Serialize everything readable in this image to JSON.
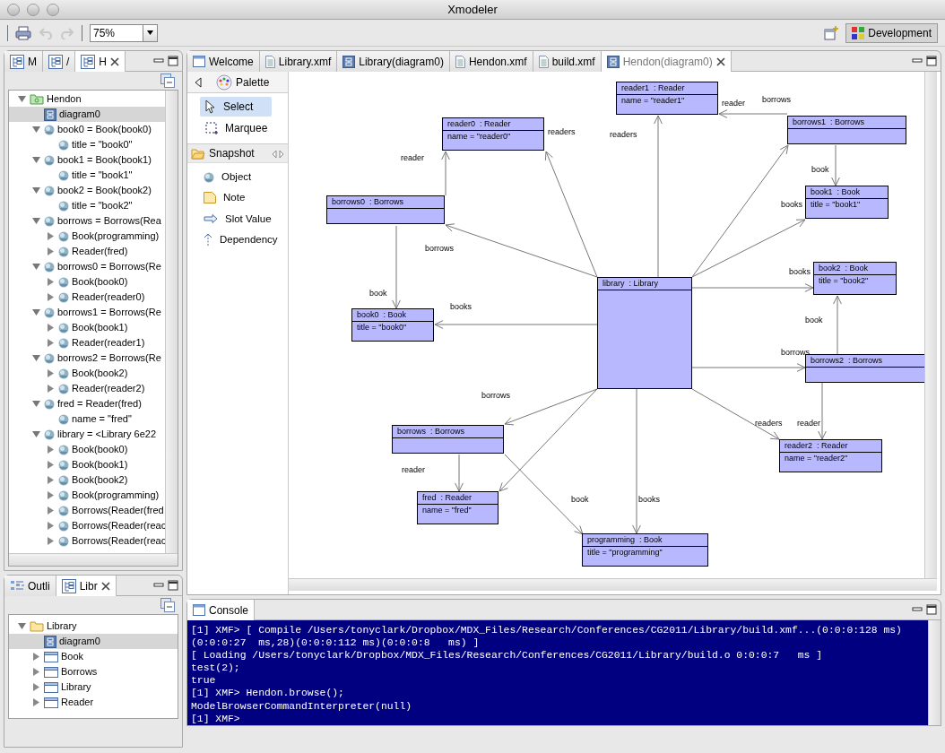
{
  "window": {
    "title": "Xmodeler"
  },
  "toolbar": {
    "zoom": "75%",
    "undo_disabled": true,
    "redo_disabled": true,
    "perspective": {
      "label": "Development",
      "selected": true
    }
  },
  "browser_panel": {
    "tabs": [
      {
        "label": "M",
        "selected": false
      },
      {
        "label": "/",
        "selected": false
      },
      {
        "label": "H",
        "selected": true
      }
    ],
    "tree": [
      {
        "label": "Hendon",
        "kind": "package",
        "expanded": true,
        "selected": false,
        "children": [
          {
            "label": "diagram0",
            "kind": "diagram",
            "selected": true
          },
          {
            "label": "book0 = Book(book0)",
            "kind": "object",
            "expanded": true,
            "selected": false,
            "children": [
              {
                "label": "title = \"book0\"",
                "kind": "object",
                "selected": false
              }
            ]
          },
          {
            "label": "book1 = Book(book1)",
            "kind": "object",
            "expanded": true,
            "selected": false,
            "children": [
              {
                "label": "title = \"book1\"",
                "kind": "object",
                "selected": false
              }
            ]
          },
          {
            "label": "book2 = Book(book2)",
            "kind": "object",
            "expanded": true,
            "selected": false,
            "children": [
              {
                "label": "title = \"book2\"",
                "kind": "object",
                "selected": false
              }
            ]
          },
          {
            "label": "borrows = Borrows(Rea",
            "kind": "object",
            "expanded": true,
            "selected": false,
            "children": [
              {
                "label": "Book(programming)",
                "kind": "object",
                "expanded": false,
                "selected": false
              },
              {
                "label": "Reader(fred)",
                "kind": "object",
                "expanded": false,
                "selected": false
              }
            ]
          },
          {
            "label": "borrows0 = Borrows(Re",
            "kind": "object",
            "expanded": true,
            "selected": false,
            "children": [
              {
                "label": "Book(book0)",
                "kind": "object",
                "expanded": false,
                "selected": false
              },
              {
                "label": "Reader(reader0)",
                "kind": "object",
                "expanded": false,
                "selected": false
              }
            ]
          },
          {
            "label": "borrows1 = Borrows(Re",
            "kind": "object",
            "expanded": true,
            "selected": false,
            "children": [
              {
                "label": "Book(book1)",
                "kind": "object",
                "expanded": false,
                "selected": false
              },
              {
                "label": "Reader(reader1)",
                "kind": "object",
                "expanded": false,
                "selected": false
              }
            ]
          },
          {
            "label": "borrows2 = Borrows(Re",
            "kind": "object",
            "expanded": true,
            "selected": false,
            "children": [
              {
                "label": "Book(book2)",
                "kind": "object",
                "expanded": false,
                "selected": false
              },
              {
                "label": "Reader(reader2)",
                "kind": "object",
                "expanded": false,
                "selected": false
              }
            ]
          },
          {
            "label": "fred = Reader(fred)",
            "kind": "object",
            "expanded": true,
            "selected": false,
            "children": [
              {
                "label": "name = \"fred\"",
                "kind": "object",
                "selected": false
              }
            ]
          },
          {
            "label": "library = <Library 6e22",
            "kind": "object",
            "expanded": true,
            "selected": false,
            "children": [
              {
                "label": "Book(book0)",
                "kind": "object",
                "expanded": false,
                "selected": false
              },
              {
                "label": "Book(book1)",
                "kind": "object",
                "expanded": false,
                "selected": false
              },
              {
                "label": "Book(book2)",
                "kind": "object",
                "expanded": false,
                "selected": false
              },
              {
                "label": "Book(programming)",
                "kind": "object",
                "expanded": false,
                "selected": false
              },
              {
                "label": "Borrows(Reader(fred",
                "kind": "object",
                "expanded": false,
                "selected": false
              },
              {
                "label": "Borrows(Reader(reac",
                "kind": "object",
                "expanded": false,
                "selected": false
              },
              {
                "label": "Borrows(Reader(reac",
                "kind": "object",
                "expanded": false,
                "selected": false
              }
            ]
          }
        ]
      }
    ]
  },
  "library_panel": {
    "tabs": [
      {
        "label": "Outli",
        "kind": "outline",
        "selected": false
      },
      {
        "label": "Libr",
        "kind": "tree",
        "selected": true
      }
    ],
    "tree": [
      {
        "label": "Library",
        "kind": "folder",
        "expanded": true,
        "selected": false,
        "children": [
          {
            "label": "diagram0",
            "kind": "diagram",
            "selected": true
          },
          {
            "label": "Book",
            "kind": "class",
            "expanded": false,
            "selected": false
          },
          {
            "label": "Borrows",
            "kind": "class",
            "expanded": false,
            "selected": false
          },
          {
            "label": "Library",
            "kind": "class",
            "expanded": false,
            "selected": false
          },
          {
            "label": "Reader",
            "kind": "class",
            "expanded": false,
            "selected": false
          }
        ]
      }
    ]
  },
  "editor": {
    "tabs": [
      {
        "label": "Welcome",
        "kind": "window",
        "selected": false
      },
      {
        "label": "Library.xmf",
        "kind": "file",
        "selected": false
      },
      {
        "label": "Library(diagram0)",
        "kind": "diagram",
        "selected": false
      },
      {
        "label": "Hendon.xmf",
        "kind": "file",
        "selected": false
      },
      {
        "label": "build.xmf",
        "kind": "file",
        "selected": false
      },
      {
        "label": "Hendon(diagram0)",
        "kind": "diagram",
        "selected": true
      }
    ],
    "palette": {
      "title": "Palette",
      "tools": [
        {
          "label": "Select",
          "kind": "select",
          "selected": true
        },
        {
          "label": "Marquee",
          "kind": "marquee",
          "selected": false
        }
      ],
      "drawer": {
        "title": "Snapshot",
        "expanded": true,
        "items": [
          {
            "label": "Object",
            "kind": "object"
          },
          {
            "label": "Note",
            "kind": "note"
          },
          {
            "label": "Slot Value",
            "kind": "slot"
          },
          {
            "label": "Dependency",
            "kind": "dependency"
          }
        ]
      }
    },
    "diagram": {
      "objects": [
        {
          "header": "reader1  : Reader",
          "slot": "name = \"reader1\""
        },
        {
          "header": "reader0  : Reader",
          "slot": "name = \"reader0\""
        },
        {
          "header": "borrows1  : Borrows"
        },
        {
          "header": "borrows0  : Borrows"
        },
        {
          "header": "book1  : Book",
          "slot": "title = \"book1\""
        },
        {
          "header": "book2  : Book",
          "slot": "title = \"book2\""
        },
        {
          "header": "library  : Library"
        },
        {
          "header": "book0  : Book",
          "slot": "title = \"book0\""
        },
        {
          "header": "borrows2  : Borrows"
        },
        {
          "header": "borrows  : Borrows"
        },
        {
          "header": "reader2  : Reader",
          "slot": "name = \"reader2\""
        },
        {
          "header": "fred  : Reader",
          "slot": "name = \"fred\""
        },
        {
          "header": "programming  : Book",
          "slot": "title = \"programming\""
        }
      ],
      "links": [
        {
          "label": "borrows"
        },
        {
          "label": "readers"
        },
        {
          "label": "readers"
        },
        {
          "label": "reader"
        },
        {
          "label": "borrows"
        },
        {
          "label": "book"
        },
        {
          "label": "books"
        },
        {
          "label": "books"
        },
        {
          "label": "book"
        },
        {
          "label": "borrows"
        },
        {
          "label": "reader"
        },
        {
          "label": "readers"
        },
        {
          "label": "books"
        },
        {
          "label": "book"
        },
        {
          "label": "reader"
        },
        {
          "label": "borrows"
        },
        {
          "label": "reader"
        },
        {
          "label": "book"
        },
        {
          "label": "books"
        }
      ]
    }
  },
  "console": {
    "title": "Console",
    "lines": [
      "[1] XMF> [ Compile /Users/tonyclark/Dropbox/MDX_Files/Research/Conferences/CG2011/Library/build.xmf...(0:0:0:128 ms)",
      "(0:0:0:27  ms,28)(0:0:0:112 ms)(0:0:0:8   ms) ]",
      "[ Loading /Users/tonyclark/Dropbox/MDX_Files/Research/Conferences/CG2011/Library/build.o 0:0:0:7   ms ]",
      "test(2);",
      "true",
      "[1] XMF> Hendon.browse();",
      "ModelBrowserCommandInterpreter(null)",
      "[1] XMF>"
    ]
  }
}
